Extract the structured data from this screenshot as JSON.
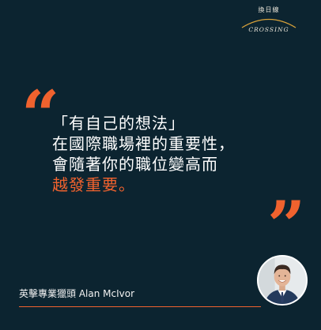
{
  "logo": {
    "cjk": "換日線",
    "wordmark": "CROSSING",
    "icon": "crossing-logo-arc"
  },
  "quote": {
    "open_mark": "“",
    "close_mark": "”",
    "lines": [
      "「有自己的想法」",
      "在國際職場裡的重要性，",
      "會隨著你的職位變高而",
      "越發重要。"
    ]
  },
  "footer": {
    "attribution": "英擊專業獵頭 Alan McIvor",
    "avatar_icon": "speaker-portrait"
  },
  "colors": {
    "background": "#0c2430",
    "accent": "#f0622e",
    "text": "#ffffff",
    "logo": "#e9e4d8"
  }
}
